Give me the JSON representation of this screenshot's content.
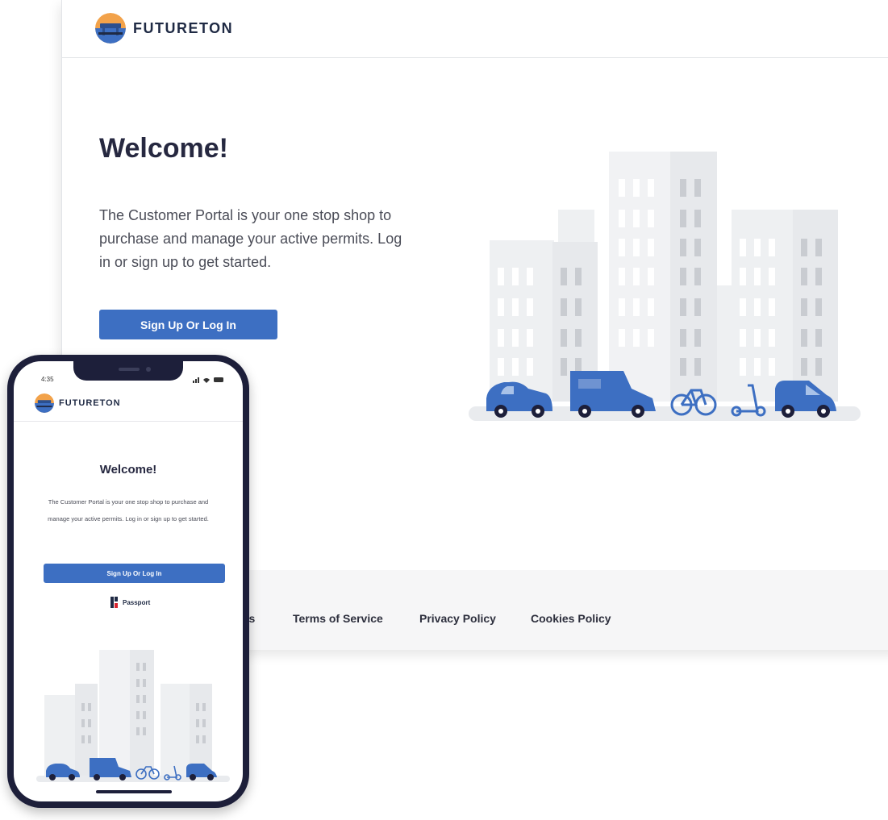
{
  "brand": {
    "name": "FUTURETON",
    "colors": {
      "primary": "#3d6fc2",
      "dark_navy": "#1d1f3a",
      "footer_bg": "#f6f6f7",
      "building": "#e7e9ec"
    }
  },
  "desktop": {
    "header": {
      "logo_icon": "futureton-logo-icon"
    },
    "hero": {
      "title": "Welcome!",
      "description": "The Customer Portal is your one stop shop to purchase and manage your active permits. Log in or sign up to get started.",
      "cta_label": "Sign Up Or Log In"
    },
    "illustration": {
      "icon": "city-vehicles-illustration"
    },
    "footer": {
      "links": [
        "ns",
        "Terms of Service",
        "Privacy Policy",
        "Cookies Policy"
      ]
    }
  },
  "phone": {
    "status": {
      "time": "4:35",
      "icons": "signal-wifi-battery-icons"
    },
    "hero": {
      "title": "Welcome!",
      "description": "The Customer Portal is your one stop shop to purchase and manage your active permits. Log in or sign up to get started.",
      "cta_label": "Sign Up Or Log In"
    },
    "powered_by": {
      "name": "Passport",
      "icon": "passport-logo-icon"
    }
  }
}
